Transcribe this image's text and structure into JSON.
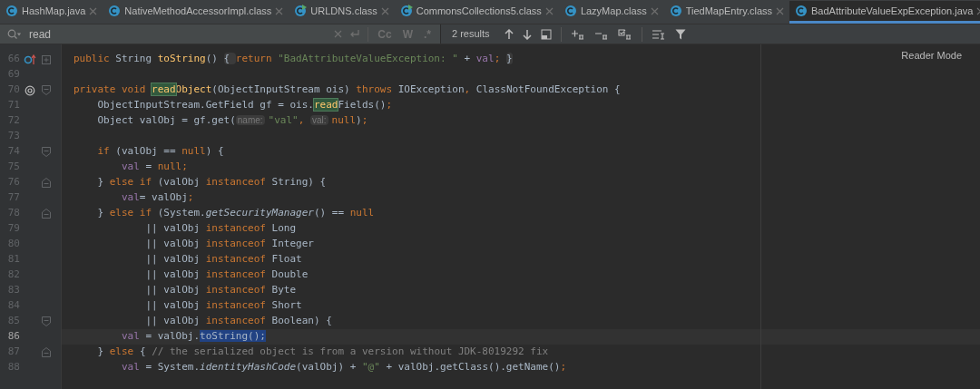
{
  "tabs": [
    {
      "label": "HashMap.java",
      "selected": false,
      "runnable": false
    },
    {
      "label": "NativeMethodAccessorImpl.class",
      "selected": false,
      "runnable": false
    },
    {
      "label": "URLDNS.class",
      "selected": false,
      "runnable": true
    },
    {
      "label": "CommonsCollections5.class",
      "selected": false,
      "runnable": true
    },
    {
      "label": "LazyMap.class",
      "selected": false,
      "runnable": false
    },
    {
      "label": "TiedMapEntry.class",
      "selected": false,
      "runnable": false
    },
    {
      "label": "BadAttributeValueExpException.java",
      "selected": true,
      "runnable": false
    }
  ],
  "search": {
    "value": "read",
    "options": [
      "Cc",
      "W",
      ".*"
    ],
    "results": "2 results"
  },
  "editor": {
    "reader_mode": "Reader Mode",
    "lines": [
      {
        "number": "66",
        "current": false,
        "gutter": {
          "kind": "override"
        },
        "fold": {
          "kind": "collapsed"
        },
        "tokens": [
          {
            "t": "public ",
            "kind": "kw"
          },
          {
            "t": "String ",
            "kind": "plain"
          },
          {
            "t": "toString",
            "kind": "method"
          },
          {
            "t": "() ",
            "kind": "plain"
          },
          {
            "t": "{ ",
            "kind": "fold"
          },
          {
            "t": "return ",
            "kind": "kw"
          },
          {
            "t": "\"BadAttributeValueException: \"",
            "kind": "str"
          },
          {
            "t": " + ",
            "kind": "plain"
          },
          {
            "t": "val",
            "kind": "field"
          },
          {
            "t": "; ",
            "kind": "kw"
          },
          {
            "t": "}",
            "kind": "fold"
          }
        ]
      },
      {
        "number": "69",
        "current": false
      },
      {
        "number": "70",
        "current": false,
        "gutter": {
          "kind": "at"
        },
        "fold": {
          "kind": "open"
        },
        "tokens": [
          {
            "t": "private void ",
            "kind": "kw"
          },
          {
            "t": "read",
            "kind": "match"
          },
          {
            "t": "Object",
            "kind": "method"
          },
          {
            "t": "(ObjectInputStream ois) ",
            "kind": "plain"
          },
          {
            "t": "throws ",
            "kind": "kw"
          },
          {
            "t": "IOException",
            "kind": "plain"
          },
          {
            "t": ", ",
            "kind": "kw"
          },
          {
            "t": "ClassNotFoundException {",
            "kind": "plain"
          }
        ]
      },
      {
        "number": "71",
        "current": false,
        "tokens": [
          {
            "t": "    ObjectInputStream.GetField gf = ois.",
            "kind": "plain"
          },
          {
            "t": "read",
            "kind": "match"
          },
          {
            "t": "Fields()",
            "kind": "plain"
          },
          {
            "t": ";",
            "kind": "kw"
          }
        ]
      },
      {
        "number": "72",
        "current": false,
        "tokens": [
          {
            "t": "    Object valObj = gf.get(",
            "kind": "plain"
          },
          {
            "t": "name:",
            "kind": "hint"
          },
          {
            "t": "\"val\"",
            "kind": "str"
          },
          {
            "t": ", ",
            "kind": "kw"
          },
          {
            "t": "val:",
            "kind": "hint"
          },
          {
            "t": "null",
            "kind": "kw"
          },
          {
            "t": ")",
            "kind": "plain"
          },
          {
            "t": ";",
            "kind": "kw"
          }
        ]
      },
      {
        "number": "73",
        "current": false
      },
      {
        "number": "74",
        "current": false,
        "fold": {
          "kind": "open"
        },
        "tokens": [
          {
            "t": "    if ",
            "kind": "kw"
          },
          {
            "t": "(valObj == ",
            "kind": "plain"
          },
          {
            "t": "null",
            "kind": "kw"
          },
          {
            "t": ") {",
            "kind": "plain"
          }
        ]
      },
      {
        "number": "75",
        "current": false,
        "tokens": [
          {
            "t": "        val",
            "kind": "field"
          },
          {
            "t": " = ",
            "kind": "plain"
          },
          {
            "t": "null;",
            "kind": "kw"
          }
        ]
      },
      {
        "number": "76",
        "current": false,
        "fold": {
          "kind": "close"
        },
        "tokens": [
          {
            "t": "    } ",
            "kind": "plain"
          },
          {
            "t": "else if ",
            "kind": "kw"
          },
          {
            "t": "(valObj ",
            "kind": "plain"
          },
          {
            "t": "instanceof ",
            "kind": "kw"
          },
          {
            "t": "String) {",
            "kind": "plain"
          }
        ]
      },
      {
        "number": "77",
        "current": false,
        "tokens": [
          {
            "t": "        val",
            "kind": "field"
          },
          {
            "t": "= valObj",
            "kind": "plain"
          },
          {
            "t": ";",
            "kind": "kw"
          }
        ]
      },
      {
        "number": "78",
        "current": false,
        "fold": {
          "kind": "close"
        },
        "tokens": [
          {
            "t": "    } ",
            "kind": "plain"
          },
          {
            "t": "else if ",
            "kind": "kw"
          },
          {
            "t": "(System.",
            "kind": "plain"
          },
          {
            "t": "getSecurityManager",
            "kind": "italic"
          },
          {
            "t": "() == ",
            "kind": "plain"
          },
          {
            "t": "null",
            "kind": "kw"
          }
        ]
      },
      {
        "number": "79",
        "current": false,
        "tokens": [
          {
            "t": "            || valObj ",
            "kind": "plain"
          },
          {
            "t": "instanceof ",
            "kind": "kw"
          },
          {
            "t": "Long",
            "kind": "plain"
          }
        ]
      },
      {
        "number": "80",
        "current": false,
        "tokens": [
          {
            "t": "            || valObj ",
            "kind": "plain"
          },
          {
            "t": "instanceof ",
            "kind": "kw"
          },
          {
            "t": "Integer",
            "kind": "plain"
          }
        ]
      },
      {
        "number": "81",
        "current": false,
        "tokens": [
          {
            "t": "            || valObj ",
            "kind": "plain"
          },
          {
            "t": "instanceof ",
            "kind": "kw"
          },
          {
            "t": "Float",
            "kind": "plain"
          }
        ]
      },
      {
        "number": "82",
        "current": false,
        "tokens": [
          {
            "t": "            || valObj ",
            "kind": "plain"
          },
          {
            "t": "instanceof ",
            "kind": "kw"
          },
          {
            "t": "Double",
            "kind": "plain"
          }
        ]
      },
      {
        "number": "83",
        "current": false,
        "tokens": [
          {
            "t": "            || valObj ",
            "kind": "plain"
          },
          {
            "t": "instanceof ",
            "kind": "kw"
          },
          {
            "t": "Byte",
            "kind": "plain"
          }
        ]
      },
      {
        "number": "84",
        "current": false,
        "tokens": [
          {
            "t": "            || valObj ",
            "kind": "plain"
          },
          {
            "t": "instanceof ",
            "kind": "kw"
          },
          {
            "t": "Short",
            "kind": "plain"
          }
        ]
      },
      {
        "number": "85",
        "current": false,
        "fold": {
          "kind": "open"
        },
        "tokens": [
          {
            "t": "            || valObj ",
            "kind": "plain"
          },
          {
            "t": "instanceof ",
            "kind": "kw"
          },
          {
            "t": "Boolean) {",
            "kind": "plain"
          }
        ]
      },
      {
        "number": "86",
        "current": true,
        "tokens": [
          {
            "t": "        val",
            "kind": "field"
          },
          {
            "t": " = valObj.",
            "kind": "plain"
          },
          {
            "t": "toString();",
            "kind": "selection"
          }
        ]
      },
      {
        "number": "87",
        "current": false,
        "fold": {
          "kind": "close"
        },
        "tokens": [
          {
            "t": "    } ",
            "kind": "plain"
          },
          {
            "t": "else ",
            "kind": "kw"
          },
          {
            "t": "{ ",
            "kind": "plain"
          },
          {
            "t": "// the serialized object is from a version without JDK-8019292 fix",
            "kind": "comment"
          }
        ]
      },
      {
        "number": "88",
        "current": false,
        "tokens": [
          {
            "t": "        val",
            "kind": "field"
          },
          {
            "t": " = System.",
            "kind": "plain"
          },
          {
            "t": "identityHashCode",
            "kind": "italic"
          },
          {
            "t": "(valObj) + ",
            "kind": "plain"
          },
          {
            "t": "\"@\"",
            "kind": "str"
          },
          {
            "t": " + valObj.getClass().getName()",
            "kind": "plain"
          },
          {
            "t": ";",
            "kind": "kw"
          }
        ]
      }
    ]
  }
}
